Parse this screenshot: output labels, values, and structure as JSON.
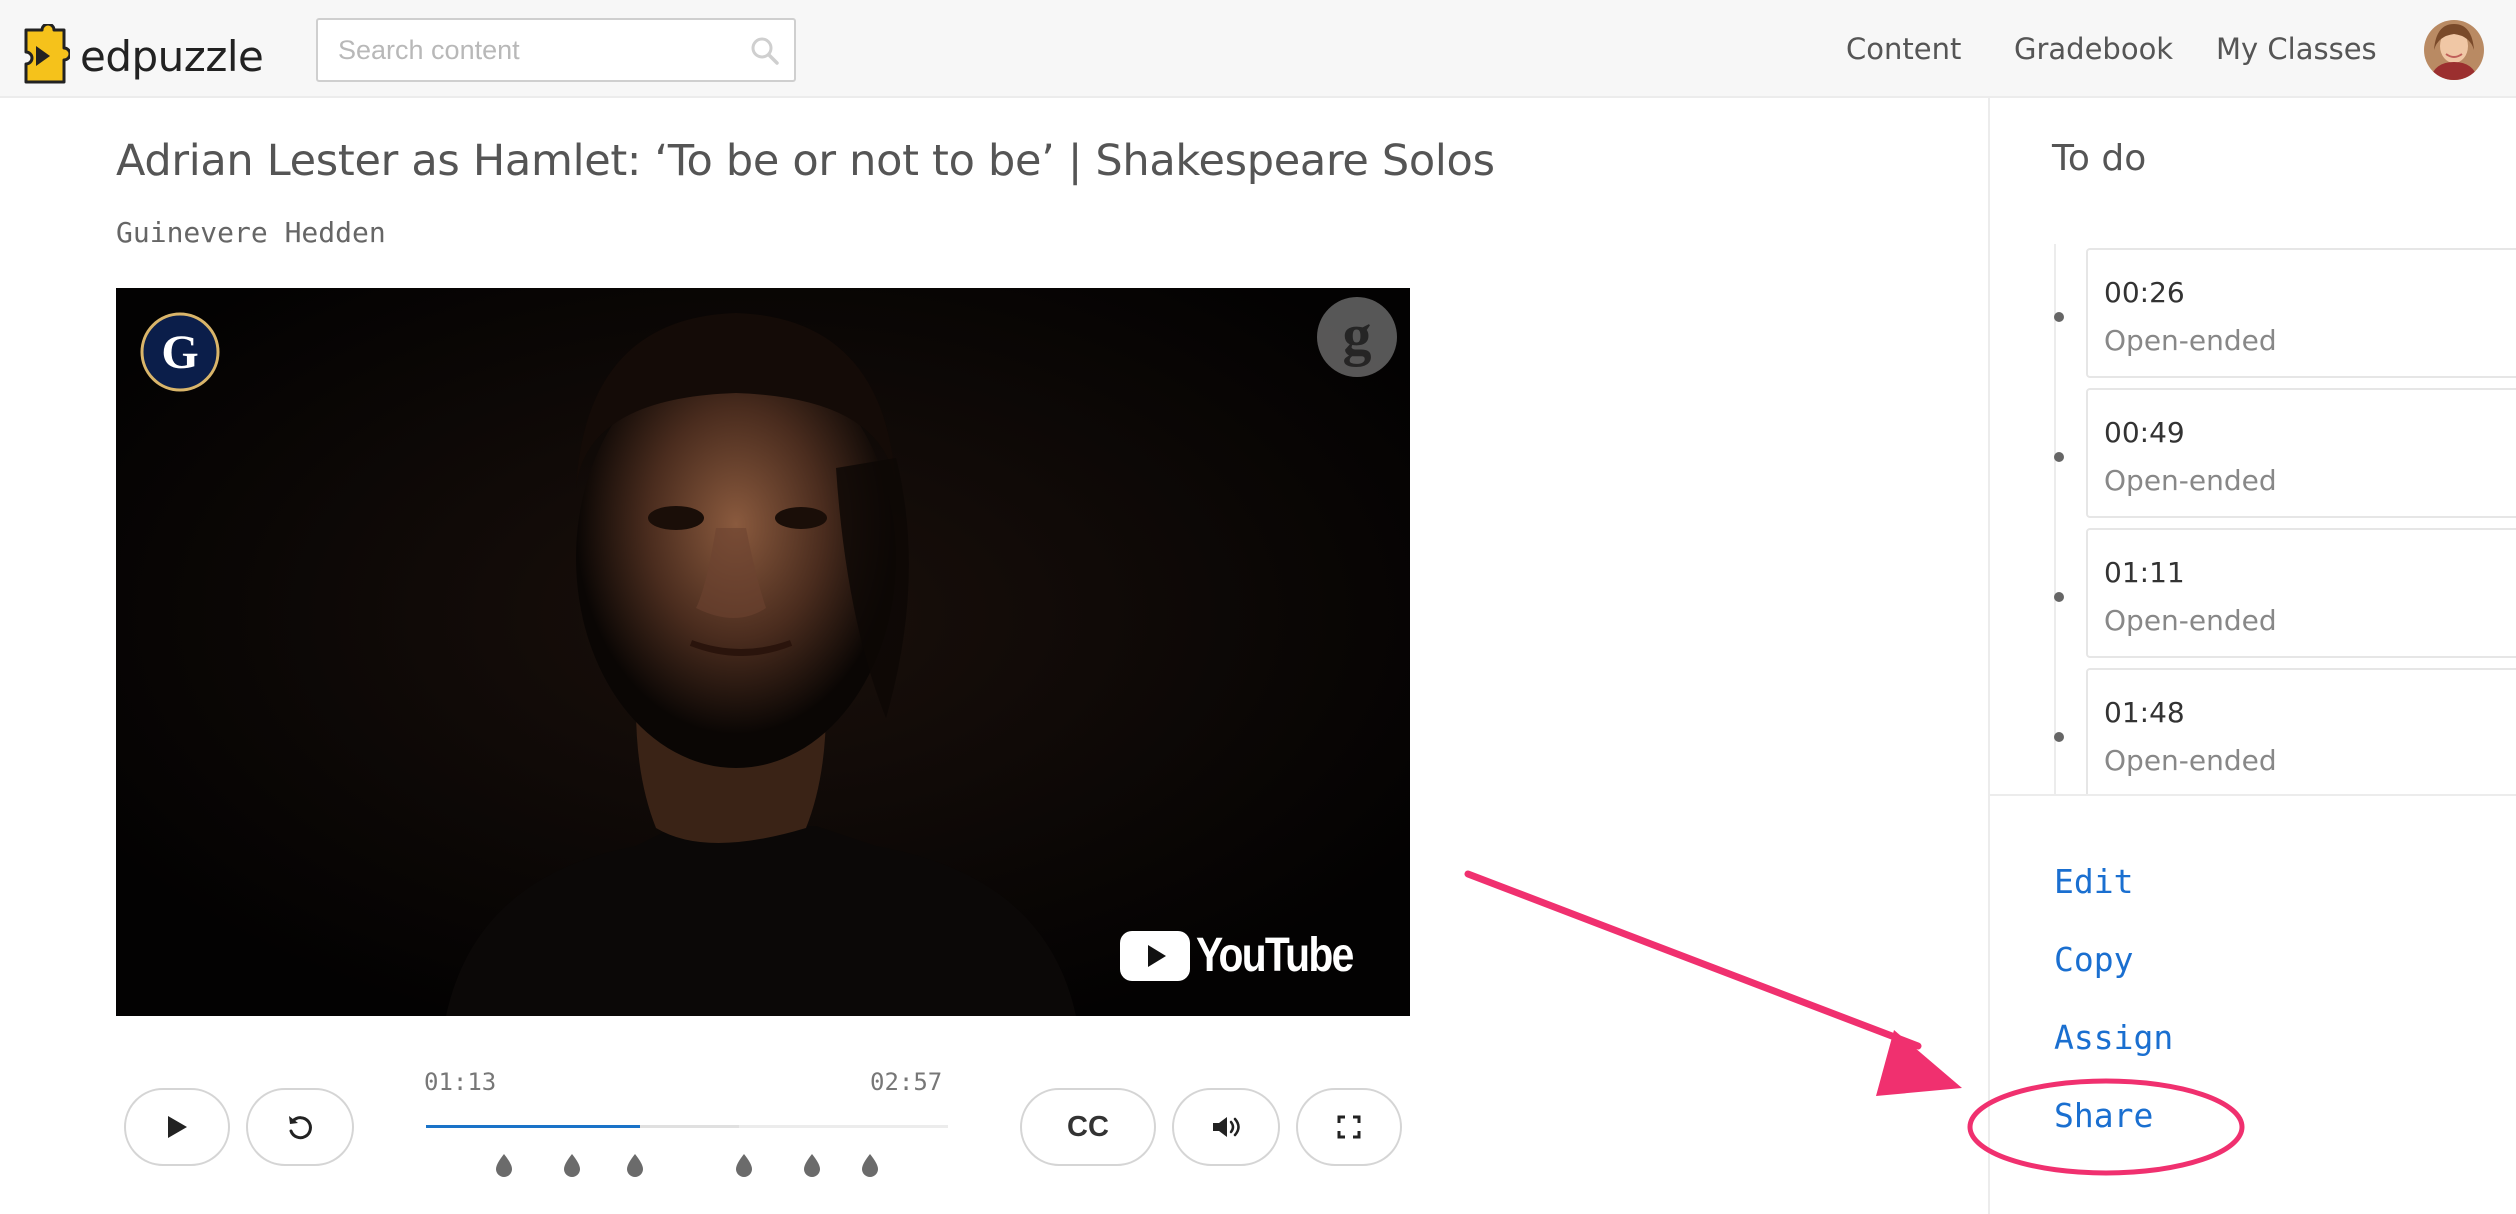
{
  "app": {
    "logo_text": "edpuzzle",
    "brand_color": "#f5c21b"
  },
  "search": {
    "placeholder": "Search content"
  },
  "nav": {
    "content": "Content",
    "gradebook": "Gradebook",
    "my_classes": "My Classes"
  },
  "video": {
    "title": "Adrian Lester as Hamlet: ‘To be or not to be’ | Shakespeare Solos",
    "author": "Guinevere Hedden",
    "youtube_label": "YouTube",
    "badge_letter": "G",
    "corner_letter": "g"
  },
  "player": {
    "current_time": "01:13",
    "total_time": "02:57",
    "progress_fraction": 0.41,
    "cc_label": "CC",
    "question_marker_fractions": [
      0.15,
      0.28,
      0.4,
      0.61,
      0.74,
      0.85
    ]
  },
  "todo": {
    "heading": "To do",
    "questions": [
      {
        "time": "00:26",
        "type": "Open-ended"
      },
      {
        "time": "00:49",
        "type": "Open-ended"
      },
      {
        "time": "01:11",
        "type": "Open-ended"
      },
      {
        "time": "01:48",
        "type": "Open-ended"
      }
    ]
  },
  "actions": {
    "edit": "Edit",
    "copy": "Copy",
    "assign": "Assign",
    "share": "Share"
  },
  "annotation": {
    "color": "#f0306f"
  }
}
